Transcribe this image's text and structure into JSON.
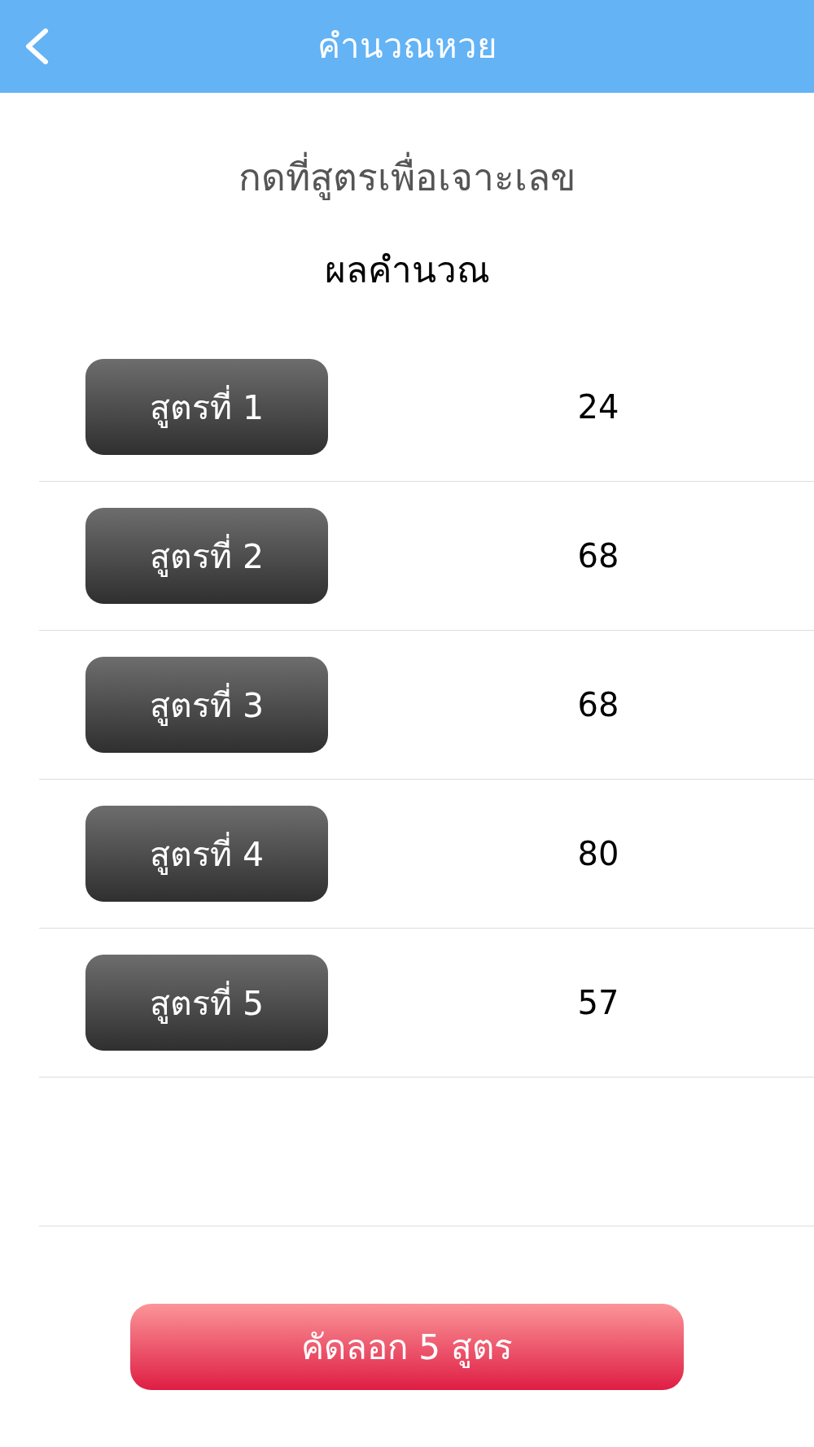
{
  "header": {
    "title": "คำนวณหวย"
  },
  "instruction": "กดที่สูตรเพื่อเจาะเลข",
  "results_heading": "ผลคำนวณ",
  "formulas": [
    {
      "label": "สูตรที่ 1",
      "value": "24"
    },
    {
      "label": "สูตรที่ 2",
      "value": "68"
    },
    {
      "label": "สูตรที่ 3",
      "value": "68"
    },
    {
      "label": "สูตรที่ 4",
      "value": "80"
    },
    {
      "label": "สูตรที่ 5",
      "value": "57"
    }
  ],
  "copy_button": {
    "label": "คัดลอก 5 สูตร"
  }
}
